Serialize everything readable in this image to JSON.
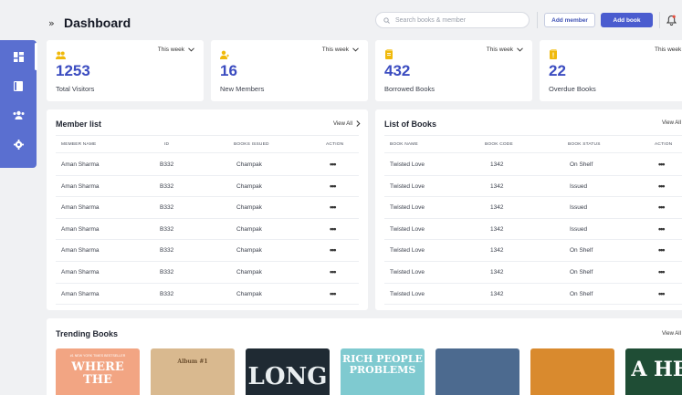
{
  "header": {
    "title": "Dashboard",
    "search_placeholder": "Search books & member",
    "add_member_label": "Add member",
    "add_book_label": "Add book"
  },
  "sidebar": {
    "items": [
      {
        "icon": "dashboard-icon"
      },
      {
        "icon": "book-icon"
      },
      {
        "icon": "members-icon"
      },
      {
        "icon": "settings-icon"
      }
    ]
  },
  "stats": [
    {
      "value": "1253",
      "label": "Total Visitors",
      "period": "This week",
      "icon": "visitors-icon"
    },
    {
      "value": "16",
      "label": "New Members",
      "period": "This week",
      "icon": "new-member-icon"
    },
    {
      "value": "432",
      "label": "Borrowed Books",
      "period": "This week",
      "icon": "borrowed-books-icon"
    },
    {
      "value": "22",
      "label": "Overdue Books",
      "period": "This week",
      "icon": "overdue-books-icon"
    }
  ],
  "member_list": {
    "title": "Member list",
    "view_all": "View All",
    "columns": [
      "MEMBER NAME",
      "ID",
      "BOOKS ISSUED",
      "ACTION"
    ],
    "rows": [
      {
        "name": "Aman Sharma",
        "id": "B332",
        "book": "Champak"
      },
      {
        "name": "Aman Sharma",
        "id": "B332",
        "book": "Champak"
      },
      {
        "name": "Aman Sharma",
        "id": "B332",
        "book": "Champak"
      },
      {
        "name": "Aman Sharma",
        "id": "B332",
        "book": "Champak"
      },
      {
        "name": "Aman Sharma",
        "id": "B332",
        "book": "Champak"
      },
      {
        "name": "Aman Sharma",
        "id": "B332",
        "book": "Champak"
      },
      {
        "name": "Aman Sharma",
        "id": "B332",
        "book": "Champak"
      }
    ],
    "action_glyph": "•••"
  },
  "book_list": {
    "title": "List of Books",
    "view_all": "View All",
    "columns": [
      "BOOK NAME",
      "BOOK CODE",
      "BOOK STATUS",
      "ACTION"
    ],
    "rows": [
      {
        "name": "Twisted Love",
        "code": "1342",
        "status": "On Shelf"
      },
      {
        "name": "Twisted Love",
        "code": "1342",
        "status": "Issued"
      },
      {
        "name": "Twisted Love",
        "code": "1342",
        "status": "Issued"
      },
      {
        "name": "Twisted Love",
        "code": "1342",
        "status": "Issued"
      },
      {
        "name": "Twisted Love",
        "code": "1342",
        "status": "On Shelf"
      },
      {
        "name": "Twisted Love",
        "code": "1342",
        "status": "On Shelf"
      },
      {
        "name": "Twisted Love",
        "code": "1342",
        "status": "On Shelf"
      }
    ],
    "action_glyph": "•••"
  },
  "trending": {
    "title": "Trending Books",
    "view_all": "View All",
    "books": [
      {
        "bg": "#f2a583",
        "text": "WHERE THE",
        "top": "#1 NEW YORK TIMES BESTSELLER",
        "fg": "#ffffff"
      },
      {
        "bg": "#d9b98f",
        "text": "Album #1",
        "top": "",
        "fg": "#6b4e2e"
      },
      {
        "bg": "#1f2a33",
        "text": "LONG",
        "top": "",
        "fg": "#e9eef0"
      },
      {
        "bg": "#7fcad0",
        "text": "RICH PEOPLE PROBLEMS",
        "top": "",
        "fg": "#ffffff"
      },
      {
        "bg": "#4c6a8f",
        "text": "",
        "top": "",
        "fg": "#ffffff"
      },
      {
        "bg": "#d98a2e",
        "text": "",
        "top": "",
        "fg": "#ffffff"
      },
      {
        "bg": "#1f4d35",
        "text": "A HEA",
        "top": "",
        "fg": "#ffffff"
      }
    ]
  },
  "colors": {
    "accent": "#4a5ccf",
    "sidebar": "#5a6fd0",
    "stat_number": "#3b4cc0",
    "stat_icon": "#f0b90b"
  }
}
